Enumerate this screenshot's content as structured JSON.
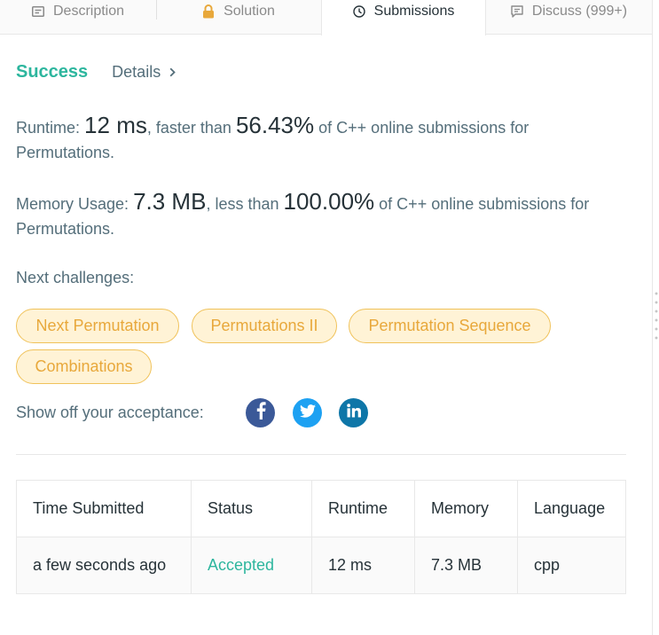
{
  "tabs": [
    {
      "label": "Description",
      "icon": "description-icon"
    },
    {
      "label": "Solution",
      "icon": "lock-icon"
    },
    {
      "label": "Submissions",
      "icon": "clock-icon"
    },
    {
      "label": "Discuss (999+)",
      "icon": "comment-icon"
    }
  ],
  "result": {
    "status": "Success",
    "details_label": "Details"
  },
  "runtime": {
    "label": "Runtime:",
    "value": "12 ms",
    "mid": ", faster than",
    "percent": "56.43%",
    "tail": "of C++ online submissions for Permutations."
  },
  "memory": {
    "label": "Memory Usage:",
    "value": "7.3 MB",
    "mid": ", less than",
    "percent": "100.00%",
    "tail": "of C++ online submissions for Permutations."
  },
  "next_challenges": {
    "label": "Next challenges:",
    "items": [
      "Next Permutation",
      "Permutations II",
      "Permutation Sequence",
      "Combinations"
    ]
  },
  "share": {
    "label": "Show off your acceptance:",
    "networks": [
      "facebook-icon",
      "twitter-icon",
      "linkedin-icon"
    ]
  },
  "table": {
    "headers": [
      "Time Submitted",
      "Status",
      "Runtime",
      "Memory",
      "Language"
    ],
    "rows": [
      [
        "a few seconds ago",
        "Accepted",
        "12 ms",
        "7.3 MB",
        "cpp"
      ]
    ]
  },
  "colors": {
    "success": "#2db69e",
    "pill_bg": "#fff3d6",
    "pill_border": "#f0c25a",
    "pill_text": "#e8a83b",
    "facebook": "#3b5998",
    "twitter": "#1da1f2",
    "linkedin": "#0e76a8"
  }
}
